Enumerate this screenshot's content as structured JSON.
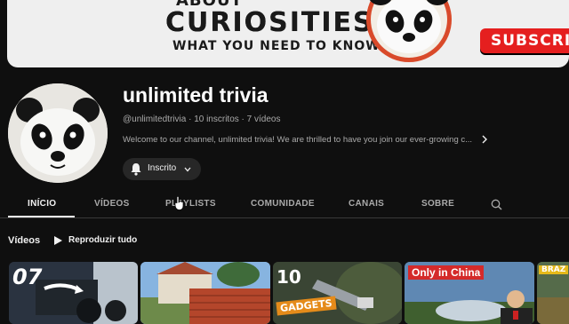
{
  "banner": {
    "line1": "ABOUT",
    "line2": "CURIOSITIES",
    "line3": "WHAT YOU NEED TO KNOW",
    "script_text": "about",
    "subscribe_label": "SUBSCRIBE"
  },
  "channel": {
    "name": "unlimited trivia",
    "handle": "@unlimitedtrivia",
    "subscribers": "10 inscritos",
    "videos_count": "7 vídeos",
    "description": "Welcome to our channel, unlimited trivia! We are thrilled to have you join our ever-growing c...",
    "subscribed_label": "Inscrito"
  },
  "tabs": [
    {
      "label": "INÍCIO",
      "active": true
    },
    {
      "label": "VÍDEOS"
    },
    {
      "label": "PLAYLISTS"
    },
    {
      "label": "COMUNIDADE"
    },
    {
      "label": "CANAIS"
    },
    {
      "label": "SOBRE"
    }
  ],
  "videos_section": {
    "title": "Vídeos",
    "play_all_label": "Reproduzir tudo"
  },
  "thumbnails": [
    {
      "overlay": "07"
    },
    {
      "overlay": ""
    },
    {
      "overlay": "10",
      "badge": "GADGETS"
    },
    {
      "overlay": "Only in China"
    },
    {
      "overlay": "BRAZ"
    }
  ],
  "colors": {
    "background": "#0f0f0f",
    "subscribe_red": "#e51f1f",
    "text_secondary": "#aaaaaa"
  },
  "icons": [
    "bell-icon",
    "chevron-down-icon",
    "chevron-right-icon",
    "search-icon",
    "play-icon"
  ]
}
